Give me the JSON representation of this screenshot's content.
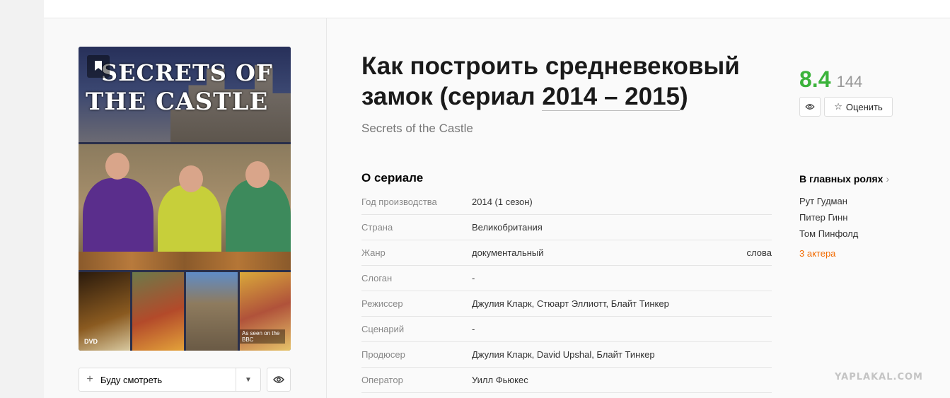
{
  "poster": {
    "title_line1": "SECRETS OF",
    "title_line2": "THE CASTLE",
    "dvd_label": "DVD",
    "bbc_label": "As seen on the BBC"
  },
  "actions": {
    "watch_label": "Буду смотреть"
  },
  "film": {
    "title_prefix": "Как построить средневековый замок (сериал ",
    "title_years": "2014 – 2015",
    "title_suffix": ")",
    "original_title": "Secrets of the Castle"
  },
  "about": {
    "heading": "О сериале",
    "rows": [
      {
        "key": "Год производства",
        "value": "2014 (1 сезон)",
        "extra": ""
      },
      {
        "key": "Страна",
        "value": "Великобритания",
        "extra": ""
      },
      {
        "key": "Жанр",
        "value": "документальный",
        "extra": "слова"
      },
      {
        "key": "Слоган",
        "value": "-",
        "extra": ""
      },
      {
        "key": "Режиссер",
        "value": "Джулия Кларк, Стюарт Эллиотт, Блайт Тинкер",
        "extra": ""
      },
      {
        "key": "Сценарий",
        "value": "-",
        "extra": ""
      },
      {
        "key": "Продюсер",
        "value": "Джулия Кларк, David Upshal, Блайт Тинкер",
        "extra": ""
      },
      {
        "key": "Оператор",
        "value": "Уилл Фьюкес",
        "extra": ""
      }
    ]
  },
  "rating": {
    "score": "8.4",
    "votes": "144",
    "rate_label": "Оценить",
    "score_color": "#3bb33b"
  },
  "cast": {
    "heading": "В главных ролях",
    "actors": [
      "Рут Гудман",
      "Питер Гинн",
      "Том Пинфолд"
    ],
    "more": "3 актера"
  },
  "watermark": "YAPLAKAL.COM"
}
